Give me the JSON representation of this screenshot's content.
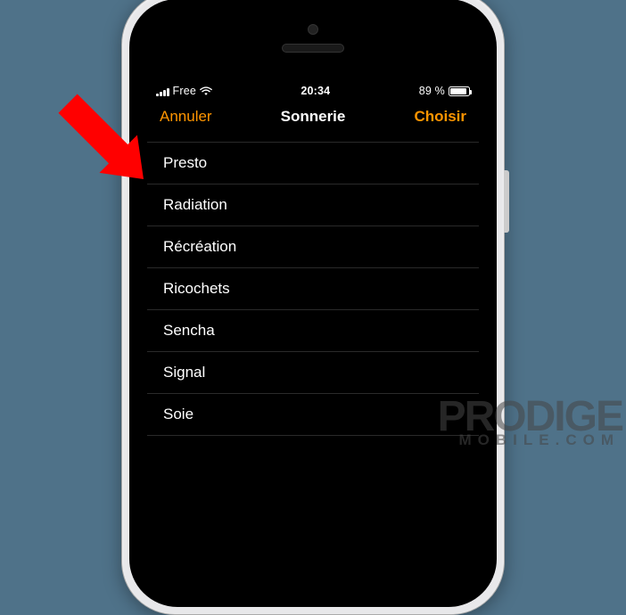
{
  "status": {
    "carrier": "Free",
    "time": "20:34",
    "battery_text": "89 %",
    "battery_pct": 89
  },
  "nav": {
    "cancel": "Annuler",
    "title": "Sonnerie",
    "action": "Choisir"
  },
  "ringtones": [
    {
      "label": "Presto"
    },
    {
      "label": "Radiation"
    },
    {
      "label": "Récréation"
    },
    {
      "label": "Ricochets"
    },
    {
      "label": "Sencha"
    },
    {
      "label": "Signal"
    },
    {
      "label": "Soie"
    }
  ],
  "watermark": {
    "line1": "PRODIGE",
    "line2": "MOBILE.COM"
  }
}
